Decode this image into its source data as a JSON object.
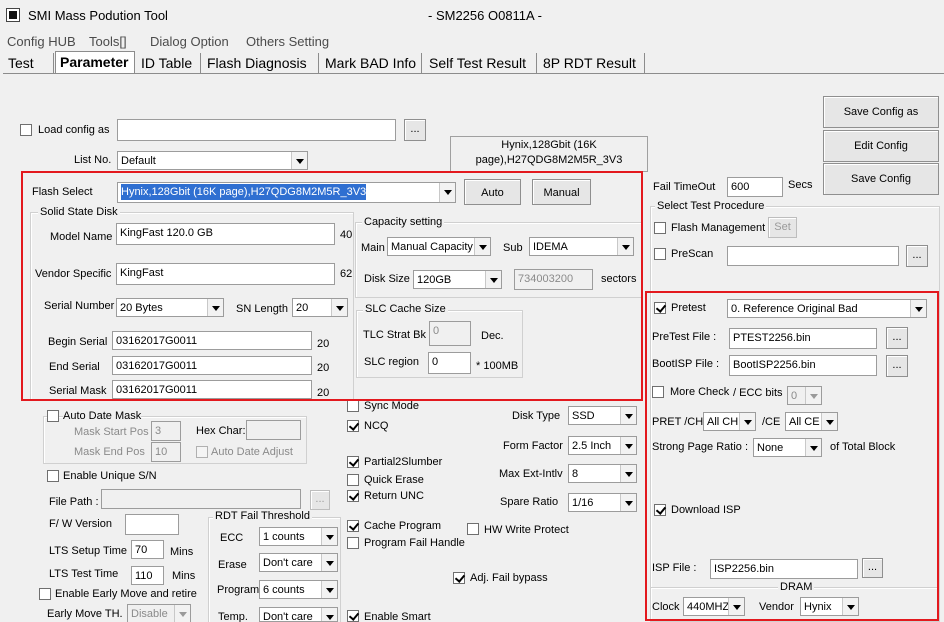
{
  "window": {
    "title": "SMI Mass Podution Tool",
    "subtitle": "- SM2256 O0811A -"
  },
  "menu": [
    "Config HUB",
    "Tools[]",
    "Dialog Option",
    "Others Setting"
  ],
  "tabs": [
    "Test",
    "Parameter",
    "ID Table",
    "Flash Diagnosis",
    "Mark BAD Info",
    "Self Test Result",
    "8P RDT Result"
  ],
  "left": {
    "load_config_label": "Load config as",
    "load_config_value": "",
    "browse": "...",
    "list_no_label": "List No.",
    "list_no_value": "Default",
    "flash_info": "Hynix,128Gbit (16K page),H27QDG8M2M5R_3V3",
    "flash_select_label": "Flash Select",
    "flash_select_value": "Hynix,128Gbit (16K page),H27QDG8M2M5R_3V3",
    "auto": "Auto",
    "manual": "Manual",
    "ssd_group": "Solid State Disk",
    "model_name_label": "Model Name",
    "model_name_value": "KingFast 120.0 GB",
    "model_name_max": "40",
    "vendor_specific_label": "Vendor Specific",
    "vendor_specific_value": "KingFast",
    "vendor_specific_max": "62",
    "serial_number_label": "Serial Number",
    "serial_number_value": "20 Bytes",
    "sn_length_label": "SN Length",
    "sn_length_value": "20",
    "begin_serial_label": "Begin Serial",
    "begin_serial_value": "03162017G0011",
    "begin_serial_len": "20",
    "end_serial_label": "End Serial",
    "end_serial_value": "03162017G0011",
    "end_serial_len": "20",
    "serial_mask_label": "Serial Mask",
    "serial_mask_value": "03162017G0011",
    "serial_mask_len": "20",
    "capacity_group": "Capacity setting",
    "main_label": "Main",
    "main_value": "Manual Capacity",
    "sub_label": "Sub",
    "sub_value": "IDEMA",
    "disk_size_label": "Disk Size",
    "disk_size_value": "120GB",
    "sectors_value": "734003200",
    "sectors_label": "sectors",
    "slc_group": "SLC Cache Size",
    "tlc_label": "TLC Strat Bk",
    "tlc_value": "0",
    "dec": "Dec.",
    "slc_region_label": "SLC region",
    "slc_region_value": "0",
    "slc_unit": "* 100MB",
    "auto_date_mask": "Auto Date Mask",
    "mask_start_label": "Mask Start Pos",
    "mask_start_value": "3",
    "mask_end_label": "Mask End Pos",
    "mask_end_value": "10",
    "hex_char_label": "Hex Char:",
    "auto_date_adjust": "Auto Date Adjust",
    "enable_unique_sn": "Enable Unique S/N",
    "file_path_label": "File Path :",
    "fw_version_label": "F/ W Version",
    "lts_setup_label": "LTS Setup Time",
    "lts_setup_value": "70",
    "lts_setup_unit": "Mins",
    "lts_test_label": "LTS Test Time",
    "lts_test_value": "110",
    "lts_test_unit": "Mins",
    "early_move": "Enable Early Move and retire",
    "early_move_th_label": "Early Move TH.",
    "early_move_th_value": "Disable",
    "rdt_group": "RDT Fail Threshold",
    "ecc_label": "ECC",
    "ecc_value": "1 counts",
    "erase_label": "Erase",
    "erase_value": "Don't care",
    "program_label": "Program",
    "program_value": "6 counts",
    "temp_label": "Temp.",
    "temp_value": "Don't care"
  },
  "mid": {
    "sync_mode": "Sync Mode",
    "ncq": "NCQ",
    "partial2slumber": "Partial2Slumber",
    "quick_erase": "Quick Erase",
    "return_unc": "Return UNC",
    "cache_program": "Cache Program",
    "program_fail_handle": "Program Fail Handle",
    "hw_write_protect": "HW Write Protect",
    "adj_fail_bypass": "Adj. Fail bypass",
    "enable_smart": "Enable Smart",
    "disk_type_label": "Disk Type",
    "disk_type_value": "SSD",
    "form_factor_label": "Form Factor",
    "form_factor_value": "2.5 Inch",
    "max_ext_label": "Max Ext-Intlv",
    "max_ext_value": "8",
    "spare_ratio_label": "Spare Ratio",
    "spare_ratio_value": "1/16"
  },
  "right": {
    "save_config_as": "Save Config as",
    "edit_config": "Edit Config",
    "save_config": "Save Config",
    "fail_timeout_label": "Fail TimeOut",
    "fail_timeout_value": "600",
    "secs": "Secs",
    "select_group": "Select Test Procedure",
    "flash_management": "Flash Management",
    "set": "Set",
    "prescan": "PreScan",
    "browse": "...",
    "pretest": "Pretest",
    "pretest_value": "0. Reference Original Bad",
    "pretest_file_label": "PreTest File :",
    "pretest_file_value": "PTEST2256.bin",
    "bootisp_label": "BootISP File :",
    "bootisp_value": "BootISP2256.bin",
    "more_check": "More Check",
    "ecc_bits_label": "/ ECC bits",
    "ecc_bits_value": "0",
    "pret_ch_label": "PRET /CH",
    "pret_ch_value": "All CH",
    "ce_label": "/CE",
    "ce_value": "All CE",
    "strong_page_label": "Strong Page Ratio :",
    "strong_page_value": "None",
    "of_total": "of Total Block",
    "download_isp": "Download ISP",
    "isp_file_label": "ISP File :",
    "isp_file_value": "ISP2256.bin",
    "dram_label": "DRAM",
    "clock_label": "Clock",
    "clock_value": "440MHZ",
    "vendor_label": "Vendor",
    "vendor_value": "Hynix"
  },
  "colors": {
    "highlight": "#e3191e",
    "selection": "#2f6fd1",
    "background": "#f0f0f0"
  }
}
